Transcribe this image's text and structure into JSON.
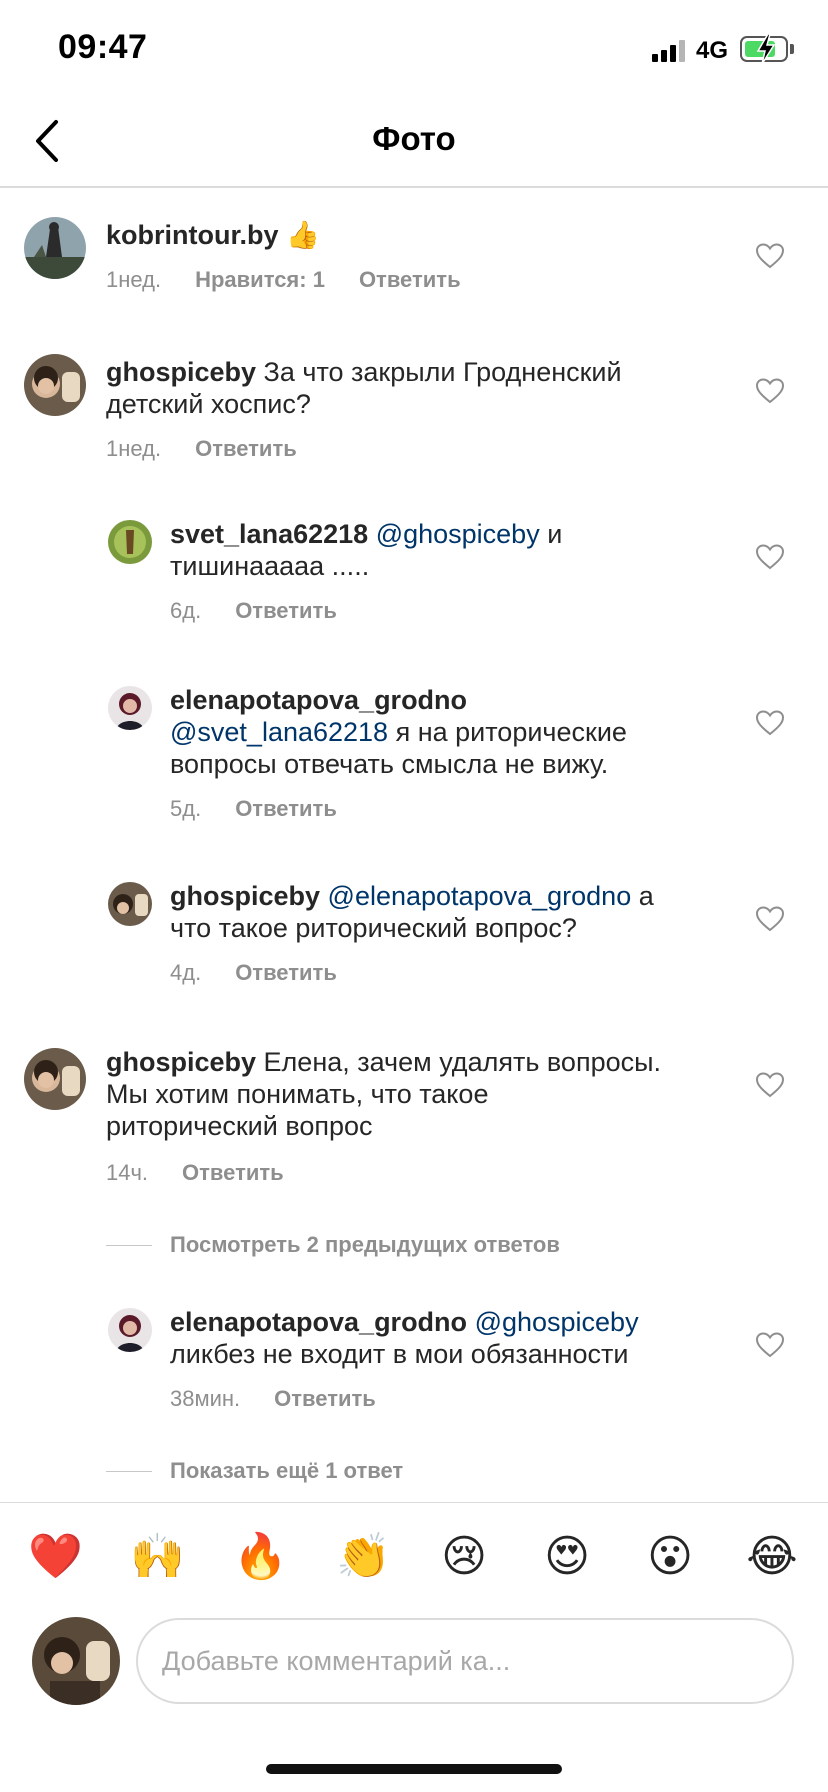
{
  "status_bar": {
    "time": "09:47",
    "network": "4G"
  },
  "header": {
    "title": "Фото"
  },
  "comments": [
    {
      "user": "kobrintour.by",
      "text": "",
      "emoji": "👍",
      "time": "1нед.",
      "likes": "Нравится: 1",
      "reply": "Ответить"
    },
    {
      "user": "ghospiceby",
      "text_lines": [
        "За что закрыли Гродненский",
        "детский хоспис?"
      ],
      "time": "1нед.",
      "reply": "Ответить"
    },
    {
      "user": "svet_lana62218",
      "mention": "@ghospiceby",
      "text_line1_tail": "и",
      "text_line2": "тишинааааа .....",
      "time": "6д.",
      "reply": "Ответить"
    },
    {
      "user": "elenapotapova_grodno",
      "mention": "@svet_lana62218",
      "text_line2_tail": "я на риторические",
      "text_line3": "вопросы отвечать смысла не вижу.",
      "time": "5д.",
      "reply": "Ответить"
    },
    {
      "user": "ghospiceby",
      "mention": "@elenapotapova_grodno",
      "text_line1_tail": "а",
      "text_line2": "что такое риторический вопрос?",
      "time": "4д.",
      "reply": "Ответить"
    },
    {
      "user": "ghospiceby",
      "text_lines": [
        "Елена, зачем удалять вопросы.",
        "Мы хотим понимать, что такое",
        "риторический вопрос"
      ],
      "time": "14ч.",
      "reply": "Ответить"
    },
    {
      "user": "elenapotapova_grodno",
      "mention": "@ghospiceby",
      "text_line2": "ликбез не входит в мои обязанности",
      "time": "38мин.",
      "reply": "Ответить"
    }
  ],
  "view_previous": "Посмотреть 2 предыдущих ответов",
  "show_more": "Показать ещё 1 ответ",
  "emoji_bar": [
    "❤️",
    "🙌",
    "🔥",
    "👏",
    "😢",
    "😍",
    "😮",
    "😂"
  ],
  "composer": {
    "placeholder": "Добавьте комментарий ка..."
  },
  "colors": {
    "mention": "#003569",
    "meta": "#8e8e8e",
    "text": "#262626",
    "battery": "#4cd964"
  }
}
